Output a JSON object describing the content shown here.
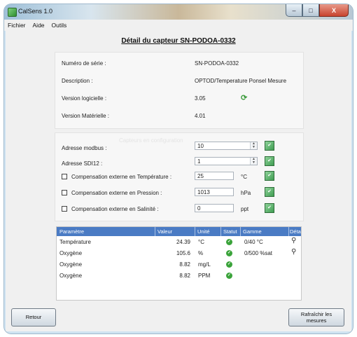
{
  "window": {
    "title": "CalSens 1.0",
    "buttons": {
      "minimize": "–",
      "maximize": "□",
      "close": "X"
    }
  },
  "menu": {
    "items": [
      "Fichier",
      "Aide",
      "Outils"
    ]
  },
  "page_title": "Détail du capteur SN-PODOA-0332",
  "info": {
    "serial_label": "Numéro de série :",
    "serial_value": "SN-PODOA-0332",
    "description_label": "Description :",
    "description_value": "OPTOD/Temperature Ponsel Mesure",
    "software_label": "Version logicielle :",
    "software_value": "3.05",
    "hardware_label": "Version Matérielle :",
    "hardware_value": "4.01"
  },
  "config": {
    "faint_text": "Capteurs en configuration",
    "modbus_label": "Adresse modbus :",
    "modbus_value": "10",
    "sdi12_label": "Adresse SDI12 :",
    "sdi12_value": "1",
    "comp_temp_label": "Compensation externe en Température :",
    "comp_temp_value": "25",
    "comp_temp_unit": "°C",
    "comp_press_label": "Compensation externe en Pression :",
    "comp_press_value": "1013",
    "comp_press_unit": "hPa",
    "comp_sal_label": "Compensation externe en Salinité :",
    "comp_sal_value": "0",
    "comp_sal_unit": "ppt"
  },
  "grid": {
    "columns": [
      "Paramètre",
      "Valeur",
      "Unité",
      "Statut",
      "Gamme",
      "Détail"
    ],
    "rows": [
      {
        "param": "Température",
        "value": "24.39",
        "unit": "°C",
        "range": "0/40 °C"
      },
      {
        "param": "Oxygène",
        "value": "105.6",
        "unit": "%",
        "range": "0/500 %sat"
      },
      {
        "param": "Oxygène",
        "value": "8.82",
        "unit": "mg/L",
        "range": ""
      },
      {
        "param": "Oxygène",
        "value": "8.82",
        "unit": "PPM",
        "range": ""
      }
    ]
  },
  "buttons": {
    "back": "Retour",
    "refresh_line1": "Rafraîchir les",
    "refresh_line2": "mesures"
  }
}
